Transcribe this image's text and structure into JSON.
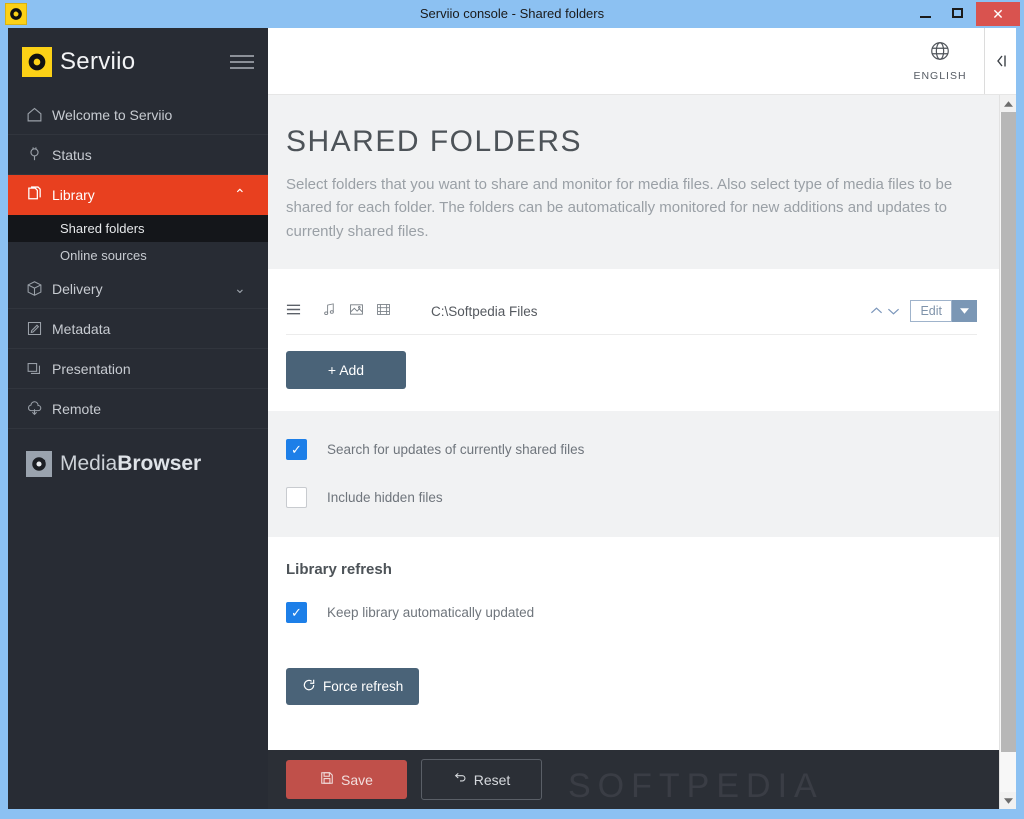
{
  "window": {
    "title": "Serviio console - Shared folders",
    "app_icon": "serviio-logo-icon",
    "minimize_label": "–",
    "maximize_label": "□",
    "close_label": "✕"
  },
  "sidebar": {
    "brand": "Serviio",
    "menu_icon": "hamburger-icon",
    "items": [
      {
        "label": "Welcome to Serviio",
        "icon": "home-icon",
        "active": false,
        "chevron": ""
      },
      {
        "label": "Status",
        "icon": "plug-icon",
        "active": false,
        "chevron": ""
      },
      {
        "label": "Library",
        "icon": "library-files-icon",
        "active": true,
        "chevron": "⌃"
      },
      {
        "label": "Delivery",
        "icon": "box-icon",
        "active": false,
        "chevron": "⌄"
      },
      {
        "label": "Metadata",
        "icon": "pencil-square-icon",
        "active": false,
        "chevron": ""
      },
      {
        "label": "Presentation",
        "icon": "windows-stack-icon",
        "active": false,
        "chevron": ""
      },
      {
        "label": "Remote",
        "icon": "cloud-download-icon",
        "active": false,
        "chevron": ""
      }
    ],
    "sub_items": [
      {
        "label": "Shared folders",
        "selected": true
      },
      {
        "label": "Online sources",
        "selected": false
      }
    ],
    "footer_logo": {
      "text_light": "Media",
      "text_bold": "Browser",
      "icon": "mediabrowser-icon"
    }
  },
  "topbar": {
    "language_label": "ENGLISH",
    "globe_icon": "globe-icon",
    "collapse_icon": "chevron-left-icon"
  },
  "hero": {
    "title": "SHARED FOLDERS",
    "description": "Select folders that you want to share and monitor for media files. Also select type of media files to be shared for each folder. The folders can be automatically monitored for new additions and updates to currently shared files."
  },
  "folders": {
    "rows": [
      {
        "handle_icon": "drag-handle-icon",
        "types": [
          {
            "icon": "music-note-icon",
            "name": "audio"
          },
          {
            "icon": "image-icon",
            "name": "image"
          },
          {
            "icon": "film-strip-icon",
            "name": "video"
          }
        ],
        "path": "C:\\Softpedia Files",
        "sort_up_icon": "chevron-up-icon",
        "sort_down_icon": "chevron-down-icon",
        "edit_label": "Edit",
        "edit_caret_icon": "caret-down-icon"
      }
    ],
    "add_label": "Add",
    "add_icon": "plus-icon"
  },
  "options": {
    "checkboxes": [
      {
        "label": "Search for updates of currently shared files",
        "checked": true
      },
      {
        "label": "Include hidden files",
        "checked": false
      }
    ]
  },
  "library_refresh": {
    "heading": "Library refresh",
    "checkbox": {
      "label": "Keep library automatically updated",
      "checked": true
    },
    "force_refresh_label": "Force refresh",
    "force_refresh_icon": "refresh-icon"
  },
  "footer": {
    "save_label": "Save",
    "save_icon": "floppy-disk-icon",
    "reset_label": "Reset",
    "reset_icon": "undo-arrow-icon"
  },
  "watermark": "SOFTPEDIA",
  "scrollbar": {
    "up_icon": "triangle-up-icon",
    "down_icon": "triangle-down-icon"
  },
  "colors": {
    "accent_red": "#e8401f",
    "sidebar_bg": "#282c34",
    "primary_button": "#4a6378",
    "save_red": "#c0504a",
    "checkbox_blue": "#1d7fe8",
    "brand_yellow": "#fcd116",
    "titlebar_blue": "#8cc1f2"
  }
}
